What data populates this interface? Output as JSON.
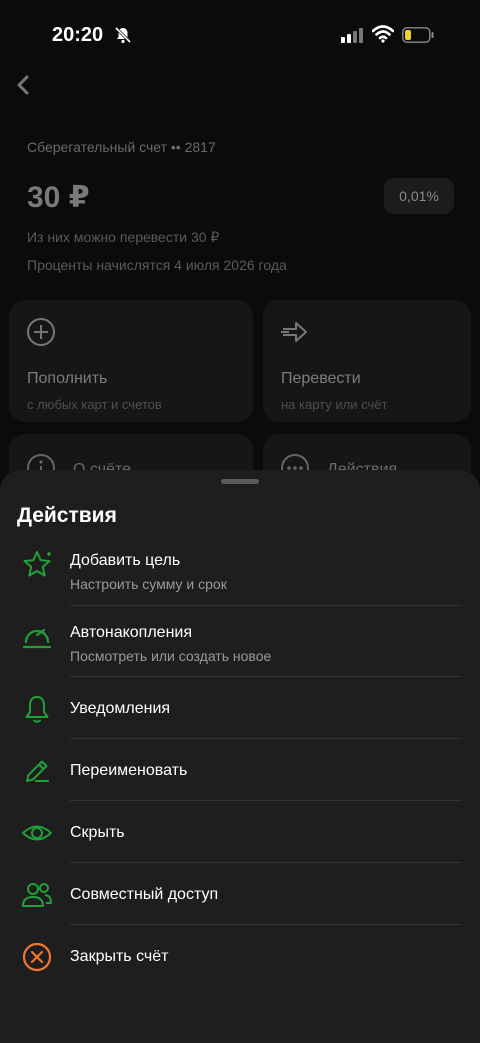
{
  "status_bar": {
    "time": "20:20"
  },
  "account": {
    "title": "Сберегательный счет •• 2817",
    "balance": "30 ₽",
    "rate": "0,01%",
    "transferable": "Из них можно перевести 30 ₽",
    "interest_date": "Проценты начислятся 4 июля 2026 года"
  },
  "cards": {
    "top_up": {
      "title": "Пополнить",
      "subtitle": "с любых карт и счетов"
    },
    "transfer": {
      "title": "Перевести",
      "subtitle": "на карту или счёт"
    },
    "about": {
      "title": "О счёте"
    },
    "actions": {
      "title": "Действия"
    }
  },
  "sheet": {
    "title": "Действия",
    "items": [
      {
        "label": "Добавить цель",
        "subtitle": "Настроить сумму и срок",
        "icon": "star-icon"
      },
      {
        "label": "Автонакопления",
        "subtitle": "Посмотреть или создать новое",
        "icon": "speedometer-icon"
      },
      {
        "label": "Уведомления",
        "icon": "bell-icon"
      },
      {
        "label": "Переименовать",
        "icon": "pencil-icon"
      },
      {
        "label": "Скрыть",
        "icon": "eye-icon"
      },
      {
        "label": "Совместный доступ",
        "icon": "users-icon"
      },
      {
        "label": "Закрыть счёт",
        "icon": "close-circle-icon"
      }
    ]
  },
  "colors": {
    "accent_green": "#21a038",
    "danger_orange": "#f0762e",
    "sheet_bg": "#1e1e1e"
  }
}
